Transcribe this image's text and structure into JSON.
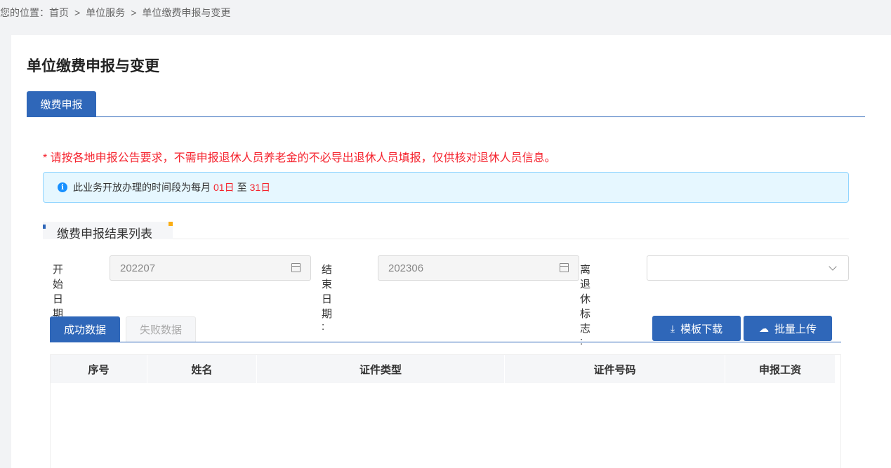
{
  "breadcrumb": {
    "prefix": "您的位置：",
    "items": [
      "首页",
      "单位服务",
      "单位缴费申报与变更"
    ],
    "sep": ">"
  },
  "page": {
    "title": "单位缴费申报与变更",
    "main_tab": "缴费申报"
  },
  "notice": "* 请按各地申报公告要求，不需申报退休人员养老金的不必导出退休人员填报，仅供核对退休人员信息。",
  "info": {
    "text_before": "此业务开放办理的时间段为每月",
    "start_day": "01日",
    "text_mid": "至",
    "end_day": "31日"
  },
  "section": {
    "title": "缴费申报结果列表"
  },
  "filters": {
    "start_label": "开始日期 :",
    "start_value": "202207",
    "end_label": "结束日期 :",
    "end_value": "202306",
    "retire_label": "离退休标志 :",
    "retire_value": ""
  },
  "sub_tabs": {
    "success": "成功数据",
    "fail": "失败数据"
  },
  "buttons": {
    "download": "模板下载",
    "upload": "批量上传"
  },
  "table": {
    "headers": [
      "序号",
      "姓名",
      "证件类型",
      "证件号码",
      "申报工资"
    ]
  },
  "colors": {
    "primary": "#2f67b9",
    "danger": "#f5222d",
    "info_bg": "#e6f7ff"
  }
}
